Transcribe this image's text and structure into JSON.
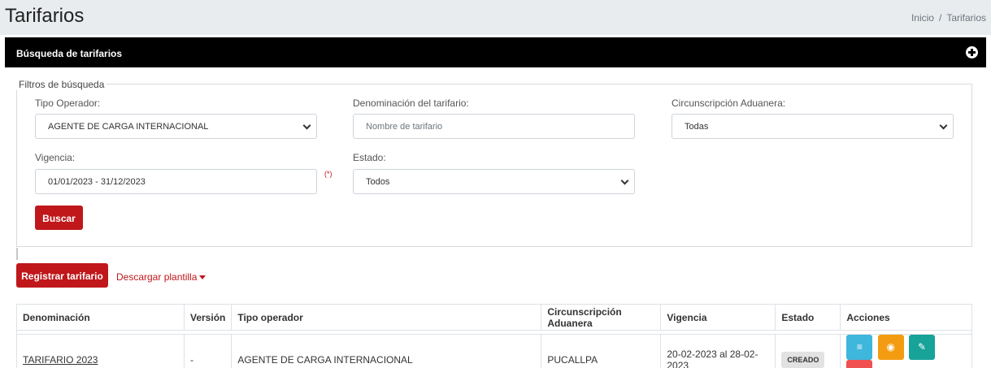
{
  "header": {
    "title": "Tarifarios",
    "breadcrumb": [
      "Inicio",
      "Tarifarios"
    ],
    "breadcrumb_separator": "/"
  },
  "card": {
    "title": "Búsqueda de tarifarios",
    "tool_icon": "collapse-plus-icon"
  },
  "filters": {
    "legend": "Filtros de búsqueda",
    "tipo_operador": {
      "label": "Tipo Operador:",
      "value": "AGENTE DE CARGA INTERNACIONAL"
    },
    "denominacion": {
      "label": "Denominación del tarifario:",
      "value": "",
      "placeholder": "Nombre de tarifario"
    },
    "circunscripcion": {
      "label": "Circunscripción Aduanera:",
      "value": "Todas"
    },
    "vigencia": {
      "label": "Vigencia:",
      "value": "01/01/2023 - 31/12/2023",
      "required_mark": "(*)"
    },
    "estado": {
      "label": "Estado:",
      "value": "Todos"
    },
    "search_button": "Buscar"
  },
  "actions": {
    "register_button": "Registrar tarifario",
    "download_link": "Descargar plantilla"
  },
  "table": {
    "columns": [
      "Denominación",
      "Versión",
      "Tipo operador",
      "Circunscripción Aduanera",
      "Vigencia",
      "Estado",
      "Acciones"
    ],
    "rows": [
      {
        "denominacion": "TARIFARIO 2023",
        "version": "-",
        "tipo_operador": "AGENTE DE CARGA INTERNACIONAL",
        "circunscripcion": "PUCALLPA",
        "vigencia": "20-02-2023 al 28-02-2023",
        "estado": "CREADO",
        "acciones": [
          "list-icon",
          "eye-icon",
          "pencil-icon",
          "close-icon"
        ]
      }
    ]
  },
  "colors": {
    "primary_red": "#c0171b",
    "card_header": "#000000",
    "header_bg": "#e9ecef",
    "info": "#3fb6dc",
    "warning": "#f39c12",
    "success": "#17a398",
    "danger": "#f0504f"
  }
}
